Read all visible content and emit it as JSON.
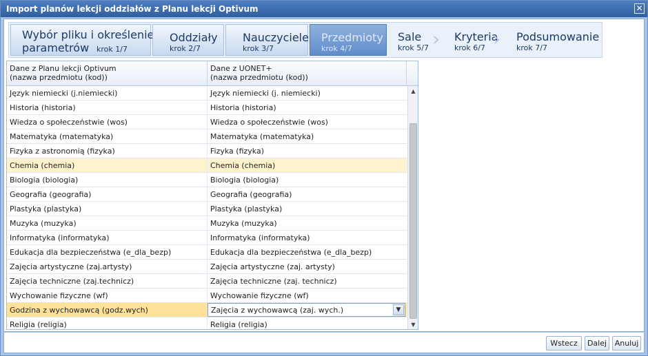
{
  "window": {
    "title": "Import planów lekcji oddziałów z Planu lekcji Optivum"
  },
  "steps": [
    {
      "label_line1": "Wybór pliku i określenie",
      "label_line2": "parametrów",
      "step": "krok 1/7"
    },
    {
      "label": "Oddziały",
      "step": "krok 2/7"
    },
    {
      "label": "Nauczyciele",
      "step": "krok 3/7"
    },
    {
      "label": "Przedmioty",
      "step": "krok 4/7"
    },
    {
      "label": "Sale",
      "step": "krok 5/7"
    },
    {
      "label": "Kryteria",
      "step": "krok 6/7"
    },
    {
      "label": "Podsumowanie",
      "step": "krok 7/7"
    }
  ],
  "grid": {
    "headers": [
      {
        "line1": "Dane z Planu lekcji Optivum",
        "line2": "(nazwa przedmiotu (kod))"
      },
      {
        "line1": "Dane z UONET+",
        "line2": "(nazwa przedmiotu (kod))"
      }
    ],
    "rows": [
      {
        "source": "Język niemiecki (j.niemiecki)",
        "target": "Język niemiecki (j. niemiecki)"
      },
      {
        "source": "Historia (historia)",
        "target": "Historia (historia)"
      },
      {
        "source": "Wiedza o społeczeństwie (wos)",
        "target": "Wiedza o społeczeństwie (wos)"
      },
      {
        "source": "Matematyka (matematyka)",
        "target": "Matematyka (matematyka)"
      },
      {
        "source": "Fizyka z astronomią (fizyka)",
        "target": "Fizyka (fizyka)"
      },
      {
        "source": "Chemia (chemia)",
        "target": "Chemia (chemia)"
      },
      {
        "source": "Biologia (biologia)",
        "target": "Biologia (biologia)"
      },
      {
        "source": "Geografia (geografia)",
        "target": "Geografia (geografia)"
      },
      {
        "source": "Plastyka (plastyka)",
        "target": "Plastyka (plastyka)"
      },
      {
        "source": "Muzyka (muzyka)",
        "target": "Muzyka (muzyka)"
      },
      {
        "source": "Informatyka (informatyka)",
        "target": "Informatyka (informatyka)"
      },
      {
        "source": "Edukacja dla bezpieczeństwa (e_dla_bezp)",
        "target": "Edukacja dla bezpieczeństwa (e_dla_bezp)"
      },
      {
        "source": "Zajęcia artystyczne (zaj.artysty)",
        "target": "Zajęcia artystyczne (zaj. artysty)"
      },
      {
        "source": "Zajęcia techniczne (zaj.technicz)",
        "target": "Zajęcia techniczne (zaj. technicz)"
      },
      {
        "source": "Wychowanie fizyczne (wf)",
        "target": "Wychowanie fizyczne (wf)"
      },
      {
        "source": "Godzina z wychowawcą (godz.wych)",
        "target": "Zajęcia z wychowawcą (zaj. wych.)"
      },
      {
        "source": "Religia (religia)",
        "target": "Religia (religia)"
      }
    ]
  },
  "buttons": {
    "back": "Wstecz",
    "next": "Dalej",
    "cancel": "Anuluj"
  },
  "icons": {
    "close": "close-icon",
    "dropdown": "chevron-down-icon",
    "scroll_up": "scroll-up-icon",
    "scroll_down": "scroll-down-icon"
  }
}
